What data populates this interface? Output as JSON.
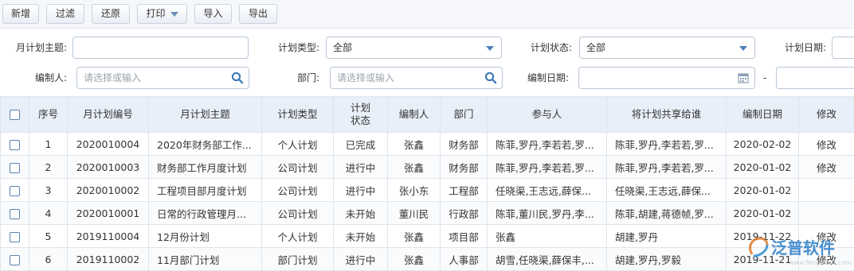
{
  "toolbar": {
    "new_label": "新增",
    "filter_label": "过滤",
    "restore_label": "还原",
    "print_label": "打印",
    "import_label": "导入",
    "export_label": "导出"
  },
  "filters": {
    "subject": {
      "label": "月计划主题:",
      "value": ""
    },
    "type": {
      "label": "计划类型:",
      "value": "全部"
    },
    "status": {
      "label": "计划状态:",
      "value": "全部"
    },
    "plan_date": {
      "label": "计划日期:",
      "value": ""
    },
    "editor": {
      "label": "编制人:",
      "placeholder": "请选择或输入"
    },
    "department": {
      "label": "部门:",
      "placeholder": "请选择或输入"
    },
    "edit_date": {
      "label": "编制日期:",
      "value": "",
      "separator": "-"
    }
  },
  "table": {
    "columns": [
      "序号",
      "月计划编号",
      "月计划主题",
      "计划类型",
      "计划状态",
      "编制人",
      "部门",
      "参与人",
      "将计划共享给谁",
      "编制日期",
      "修改"
    ],
    "rows": [
      {
        "no": "1",
        "code": "2020010004",
        "subject": "2020年财务部工作...",
        "type": "个人计划",
        "status": "已完成",
        "editor": "张鑫",
        "dept": "财务部",
        "participants": "陈菲,罗丹,李若若,罗...",
        "share": "陈菲,罗丹,李若若,罗...",
        "date": "2020-02-02",
        "edit": "修改"
      },
      {
        "no": "2",
        "code": "2020010003",
        "subject": "财务部工作月度计划",
        "type": "公司计划",
        "status": "进行中",
        "editor": "张鑫",
        "dept": "财务部",
        "participants": "陈菲,罗丹,李若若,罗...",
        "share": "陈菲,罗丹,李若若,罗...",
        "date": "2020-01-02",
        "edit": "修改"
      },
      {
        "no": "3",
        "code": "2020010002",
        "subject": "工程项目部月度计划",
        "type": "公司计划",
        "status": "进行中",
        "editor": "张小东",
        "dept": "工程部",
        "participants": "任晓渠,王志远,薛保...",
        "share": "任晓渠,王志远,薛保...",
        "date": "2020-01-02",
        "edit": ""
      },
      {
        "no": "4",
        "code": "2020010001",
        "subject": "日常的行政管理月...",
        "type": "公司计划",
        "status": "未开始",
        "editor": "董川民",
        "dept": "行政部",
        "participants": "陈菲,董川民,罗丹,李...",
        "share": "陈菲,胡建,蒋德帧,罗...",
        "date": "2020-01-02",
        "edit": ""
      },
      {
        "no": "5",
        "code": "2019110004",
        "subject": "12月份计划",
        "type": "个人计划",
        "status": "未开始",
        "editor": "张鑫",
        "dept": "项目部",
        "participants": "张鑫",
        "share": "胡建,罗丹",
        "date": "2019-11-22",
        "edit": "修改"
      },
      {
        "no": "6",
        "code": "2019110002",
        "subject": "11月部门计划",
        "type": "部门计划",
        "status": "进行中",
        "editor": "张鑫",
        "dept": "人事部",
        "participants": "胡雪,任晓渠,薛保丰,...",
        "share": "胡建,罗丹,罗毅",
        "date": "2019-11-21",
        "edit": "修改"
      }
    ]
  },
  "watermark": {
    "text": "泛普软件",
    "sub": "www.fanpusoft.com"
  },
  "colors": {
    "link": "#2c72c7",
    "header_bg": "#e8eff8",
    "border": "#b9c8d8",
    "accent": "#4a7fb5"
  }
}
